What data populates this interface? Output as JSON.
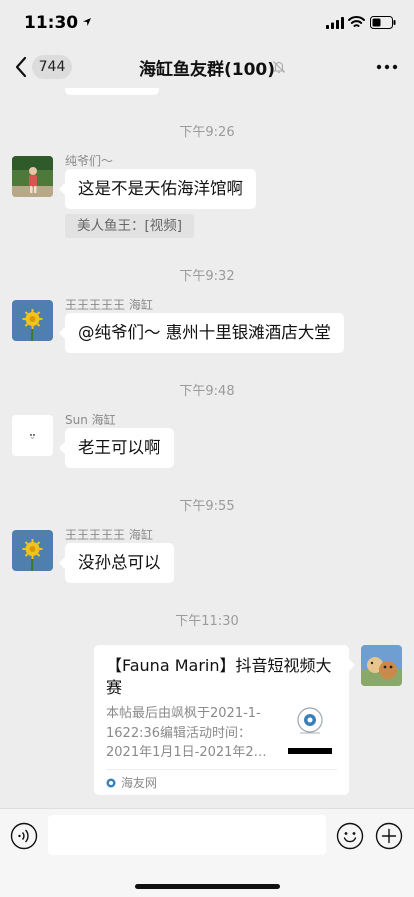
{
  "status_bar": {
    "time": "11:30",
    "icons": [
      "location-arrow-icon",
      "signal-icon",
      "wifi-icon",
      "battery-icon"
    ]
  },
  "nav": {
    "unread_count": "744",
    "title": "海缸鱼友群(100)",
    "icons": [
      "back-chevron-icon",
      "mute-bell-icon",
      "more-dots-icon"
    ]
  },
  "chat": {
    "messages": [
      {
        "time": "下午9:26",
        "sender": "纯爷们～",
        "text": "这是不是天佑海洋馆啊",
        "quote": "美人鱼王：[视频]"
      },
      {
        "time": "下午9:32",
        "sender": "王王王王王 海缸",
        "text": "@纯爷们～ 惠州十里银滩酒店大堂"
      },
      {
        "time": "下午9:48",
        "sender": "Sun 海缸",
        "text": "老王可以啊"
      },
      {
        "time": "下午9:55",
        "sender": "王王王王王 海缸",
        "text": "没孙总可以"
      },
      {
        "time": "下午11:30",
        "card": {
          "title": "【Fauna Marin】抖音短视频大赛",
          "desc_lines": [
            "本帖最后由飒枫于2021-1-",
            "1622:36编辑活动时间：",
            "2021年1月1日-2021年2…"
          ],
          "source": "海友网"
        }
      }
    ]
  },
  "input_bar": {
    "placeholder": "",
    "icons": [
      "voice-icon",
      "emoji-icon",
      "plus-icon"
    ]
  },
  "colors": {
    "background": "#ededed",
    "bubble": "#ffffff",
    "timestamp": "#9b9b9b"
  }
}
